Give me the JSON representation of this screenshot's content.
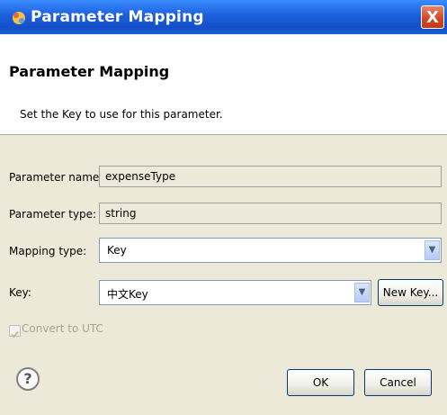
{
  "window": {
    "title": "Parameter Mapping",
    "close_glyph": "X"
  },
  "banner": {
    "title": "Parameter Mapping",
    "message": "Set the Key to use for this parameter."
  },
  "fields": {
    "parameter_name": {
      "label": "Parameter name:",
      "value": "expenseType"
    },
    "parameter_type": {
      "label": "Parameter type:",
      "value": "string"
    },
    "mapping_type": {
      "label": "Mapping type:",
      "value": "Key"
    },
    "key": {
      "label": "Key:",
      "value": "中文Key"
    }
  },
  "buttons": {
    "new_key": "New Key...",
    "ok": "OK",
    "cancel": "Cancel"
  },
  "options": {
    "convert_to_utc": "Convert to UTC",
    "convert_to_utc_checked": true,
    "convert_to_utc_enabled": false
  },
  "icons": {
    "help": "?",
    "dropdown_arrow": "▼"
  }
}
